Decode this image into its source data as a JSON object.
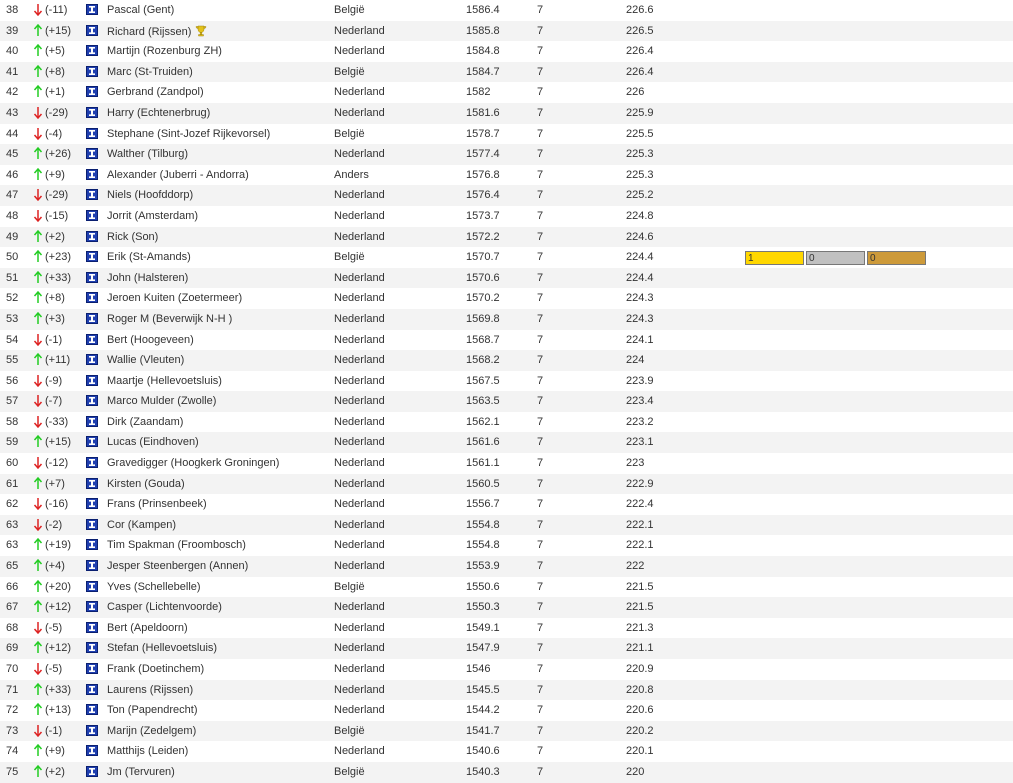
{
  "colors": {
    "up": "#22cc22",
    "down": "#dd2222",
    "flag_blue": "#1f3fb0",
    "gold": "#ffd700",
    "silver": "#c0c0c0",
    "bronze": "#cd9a3a"
  },
  "rows": [
    {
      "rank": "38",
      "dir": "down",
      "delta": "(-11)",
      "name": "Pascal (Gent)",
      "country": "België",
      "score": "1586.4",
      "games": "7",
      "avg": "226.6"
    },
    {
      "rank": "39",
      "dir": "up",
      "delta": "(+15)",
      "name": "Richard (Rijssen)",
      "country": "Nederland",
      "score": "1585.8",
      "games": "7",
      "avg": "226.5",
      "trophy": true
    },
    {
      "rank": "40",
      "dir": "up",
      "delta": "(+5)",
      "name": "Martijn (Rozenburg ZH)",
      "country": "Nederland",
      "score": "1584.8",
      "games": "7",
      "avg": "226.4"
    },
    {
      "rank": "41",
      "dir": "up",
      "delta": "(+8)",
      "name": "Marc (St-Truiden)",
      "country": "België",
      "score": "1584.7",
      "games": "7",
      "avg": "226.4"
    },
    {
      "rank": "42",
      "dir": "up",
      "delta": "(+1)",
      "name": "Gerbrand (Zandpol)",
      "country": "Nederland",
      "score": "1582",
      "games": "7",
      "avg": "226"
    },
    {
      "rank": "43",
      "dir": "down",
      "delta": "(-29)",
      "name": "Harry (Echtenerbrug)",
      "country": "Nederland",
      "score": "1581.6",
      "games": "7",
      "avg": "225.9"
    },
    {
      "rank": "44",
      "dir": "down",
      "delta": "(-4)",
      "name": "Stephane (Sint-Jozef Rijkevorsel)",
      "country": "België",
      "score": "1578.7",
      "games": "7",
      "avg": "225.5"
    },
    {
      "rank": "45",
      "dir": "up",
      "delta": "(+26)",
      "name": "Walther (Tilburg)",
      "country": "Nederland",
      "score": "1577.4",
      "games": "7",
      "avg": "225.3"
    },
    {
      "rank": "46",
      "dir": "up",
      "delta": "(+9)",
      "name": "Alexander (Juberri - Andorra)",
      "country": "Anders",
      "score": "1576.8",
      "games": "7",
      "avg": "225.3"
    },
    {
      "rank": "47",
      "dir": "down",
      "delta": "(-29)",
      "name": "Niels (Hoofddorp)",
      "country": "Nederland",
      "score": "1576.4",
      "games": "7",
      "avg": "225.2"
    },
    {
      "rank": "48",
      "dir": "down",
      "delta": "(-15)",
      "name": "Jorrit (Amsterdam)",
      "country": "Nederland",
      "score": "1573.7",
      "games": "7",
      "avg": "224.8"
    },
    {
      "rank": "49",
      "dir": "up",
      "delta": "(+2)",
      "name": "Rick (Son)",
      "country": "Nederland",
      "score": "1572.2",
      "games": "7",
      "avg": "224.6"
    },
    {
      "rank": "50",
      "dir": "up",
      "delta": "(+23)",
      "name": "Erik (St-Amands)",
      "country": "België",
      "score": "1570.7",
      "games": "7",
      "avg": "224.4",
      "medals": {
        "gold": "1",
        "silver": "0",
        "bronze": "0"
      }
    },
    {
      "rank": "51",
      "dir": "up",
      "delta": "(+33)",
      "name": "John (Halsteren)",
      "country": "Nederland",
      "score": "1570.6",
      "games": "7",
      "avg": "224.4"
    },
    {
      "rank": "52",
      "dir": "up",
      "delta": "(+8)",
      "name": "Jeroen Kuiten (Zoetermeer)",
      "country": "Nederland",
      "score": "1570.2",
      "games": "7",
      "avg": "224.3"
    },
    {
      "rank": "53",
      "dir": "up",
      "delta": "(+3)",
      "name": "Roger M (Beverwijk N-H )",
      "country": "Nederland",
      "score": "1569.8",
      "games": "7",
      "avg": "224.3"
    },
    {
      "rank": "54",
      "dir": "down",
      "delta": "(-1)",
      "name": "Bert (Hoogeveen)",
      "country": "Nederland",
      "score": "1568.7",
      "games": "7",
      "avg": "224.1"
    },
    {
      "rank": "55",
      "dir": "up",
      "delta": "(+11)",
      "name": "Wallie (Vleuten)",
      "country": "Nederland",
      "score": "1568.2",
      "games": "7",
      "avg": "224"
    },
    {
      "rank": "56",
      "dir": "down",
      "delta": "(-9)",
      "name": "Maartje (Hellevoetsluis)",
      "country": "Nederland",
      "score": "1567.5",
      "games": "7",
      "avg": "223.9"
    },
    {
      "rank": "57",
      "dir": "down",
      "delta": "(-7)",
      "name": "Marco Mulder (Zwolle)",
      "country": "Nederland",
      "score": "1563.5",
      "games": "7",
      "avg": "223.4"
    },
    {
      "rank": "58",
      "dir": "down",
      "delta": "(-33)",
      "name": "Dirk (Zaandam)",
      "country": "Nederland",
      "score": "1562.1",
      "games": "7",
      "avg": "223.2"
    },
    {
      "rank": "59",
      "dir": "up",
      "delta": "(+15)",
      "name": "Lucas (Eindhoven)",
      "country": "Nederland",
      "score": "1561.6",
      "games": "7",
      "avg": "223.1"
    },
    {
      "rank": "60",
      "dir": "down",
      "delta": "(-12)",
      "name": "Gravedigger (Hoogkerk Groningen)",
      "country": "Nederland",
      "score": "1561.1",
      "games": "7",
      "avg": "223"
    },
    {
      "rank": "61",
      "dir": "up",
      "delta": "(+7)",
      "name": "Kirsten (Gouda)",
      "country": "Nederland",
      "score": "1560.5",
      "games": "7",
      "avg": "222.9"
    },
    {
      "rank": "62",
      "dir": "down",
      "delta": "(-16)",
      "name": "Frans (Prinsenbeek)",
      "country": "Nederland",
      "score": "1556.7",
      "games": "7",
      "avg": "222.4"
    },
    {
      "rank": "63",
      "dir": "down",
      "delta": "(-2)",
      "name": "Cor (Kampen)",
      "country": "Nederland",
      "score": "1554.8",
      "games": "7",
      "avg": "222.1"
    },
    {
      "rank": "63",
      "dir": "up",
      "delta": "(+19)",
      "name": "Tim Spakman (Froombosch)",
      "country": "Nederland",
      "score": "1554.8",
      "games": "7",
      "avg": "222.1"
    },
    {
      "rank": "65",
      "dir": "up",
      "delta": "(+4)",
      "name": "Jesper Steenbergen (Annen)",
      "country": "Nederland",
      "score": "1553.9",
      "games": "7",
      "avg": "222"
    },
    {
      "rank": "66",
      "dir": "up",
      "delta": "(+20)",
      "name": "Yves (Schellebelle)",
      "country": "België",
      "score": "1550.6",
      "games": "7",
      "avg": "221.5"
    },
    {
      "rank": "67",
      "dir": "up",
      "delta": "(+12)",
      "name": "Casper (Lichtenvoorde)",
      "country": "Nederland",
      "score": "1550.3",
      "games": "7",
      "avg": "221.5"
    },
    {
      "rank": "68",
      "dir": "down",
      "delta": "(-5)",
      "name": "Bert (Apeldoorn)",
      "country": "Nederland",
      "score": "1549.1",
      "games": "7",
      "avg": "221.3"
    },
    {
      "rank": "69",
      "dir": "up",
      "delta": "(+12)",
      "name": "Stefan (Hellevoetsluis)",
      "country": "Nederland",
      "score": "1547.9",
      "games": "7",
      "avg": "221.1"
    },
    {
      "rank": "70",
      "dir": "down",
      "delta": "(-5)",
      "name": "Frank (Doetinchem)",
      "country": "Nederland",
      "score": "1546",
      "games": "7",
      "avg": "220.9"
    },
    {
      "rank": "71",
      "dir": "up",
      "delta": "(+33)",
      "name": "Laurens (Rijssen)",
      "country": "Nederland",
      "score": "1545.5",
      "games": "7",
      "avg": "220.8"
    },
    {
      "rank": "72",
      "dir": "up",
      "delta": "(+13)",
      "name": "Ton (Papendrecht)",
      "country": "Nederland",
      "score": "1544.2",
      "games": "7",
      "avg": "220.6"
    },
    {
      "rank": "73",
      "dir": "down",
      "delta": "(-1)",
      "name": "Marijn (Zedelgem)",
      "country": "België",
      "score": "1541.7",
      "games": "7",
      "avg": "220.2"
    },
    {
      "rank": "74",
      "dir": "up",
      "delta": "(+9)",
      "name": "Matthijs (Leiden)",
      "country": "Nederland",
      "score": "1540.6",
      "games": "7",
      "avg": "220.1"
    },
    {
      "rank": "75",
      "dir": "up",
      "delta": "(+2)",
      "name": "Jm (Tervuren)",
      "country": "België",
      "score": "1540.3",
      "games": "7",
      "avg": "220"
    }
  ]
}
